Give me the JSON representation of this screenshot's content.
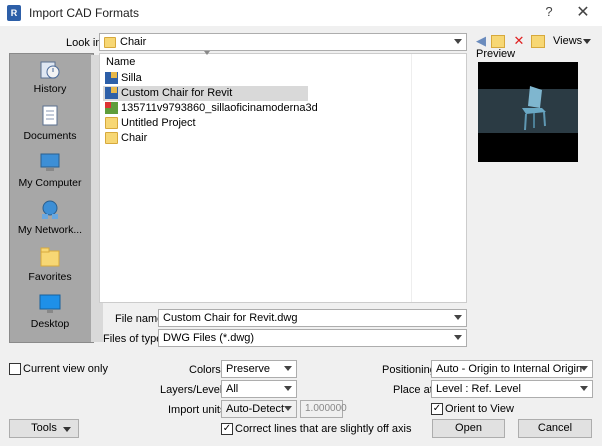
{
  "window": {
    "title": "Import CAD Formats",
    "help": "?",
    "close": "✕"
  },
  "lookin": {
    "label": "Look in:",
    "value": "Chair",
    "views_label": "Views"
  },
  "preview": {
    "label": "Preview"
  },
  "places": [
    {
      "label": "History",
      "icon": "history-icon"
    },
    {
      "label": "Documents",
      "icon": "documents-icon"
    },
    {
      "label": "My Computer",
      "icon": "computer-icon"
    },
    {
      "label": "My Network...",
      "icon": "network-icon"
    },
    {
      "label": "Favorites",
      "icon": "favorites-icon"
    },
    {
      "label": "Desktop",
      "icon": "desktop-icon"
    }
  ],
  "filelist": {
    "header": "Name",
    "items": [
      {
        "name": "Silla",
        "type": "revit"
      },
      {
        "name": "Custom Chair for Revit",
        "type": "revit",
        "selected": true
      },
      {
        "name": "135711v9793860_sillaoficinamoderna3d",
        "type": "cad"
      },
      {
        "name": "Untitled Project",
        "type": "folder"
      },
      {
        "name": "Chair",
        "type": "folder"
      }
    ]
  },
  "filename": {
    "label": "File name:",
    "value": "Custom Chair for Revit.dwg"
  },
  "filetype": {
    "label": "Files of type:",
    "value": "DWG Files  (*.dwg)"
  },
  "options": {
    "current_view_only": "Current view only",
    "colors_label": "Colors:",
    "colors_value": "Preserve",
    "layers_label": "Layers/Levels:",
    "layers_value": "All",
    "units_label": "Import units:",
    "units_value": "Auto-Detect",
    "units_factor": "1.000000",
    "correct_lines": "Correct lines that are slightly off axis",
    "positioning_label": "Positioning:",
    "positioning_value": "Auto - Origin to Internal Origin",
    "placeat_label": "Place at:",
    "placeat_value": "Level : Ref. Level",
    "orient_label": "Orient to View"
  },
  "buttons": {
    "tools": "Tools",
    "open": "Open",
    "cancel": "Cancel"
  }
}
